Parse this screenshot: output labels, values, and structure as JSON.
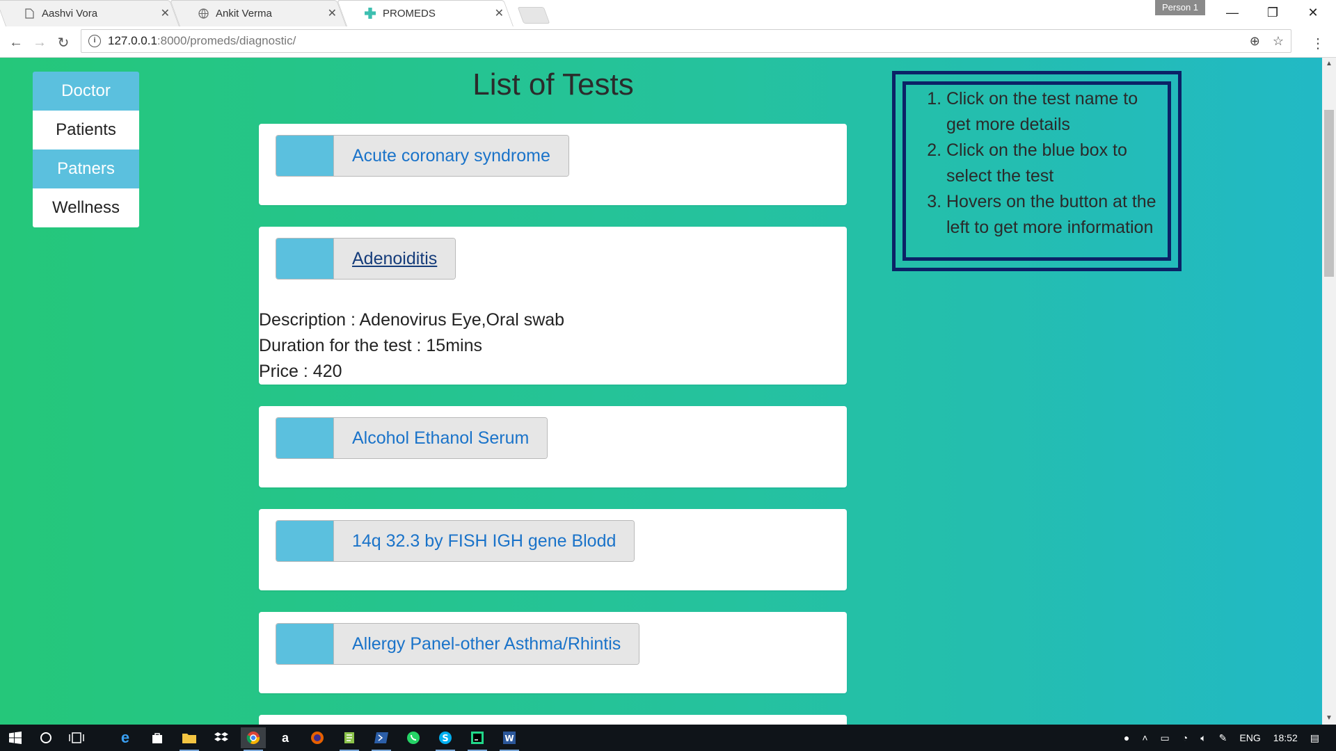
{
  "browser": {
    "tabs": [
      {
        "title": "Aashvi Vora",
        "icon": "document-icon"
      },
      {
        "title": "Ankit Verma",
        "icon": "globe-icon"
      },
      {
        "title": "PROMEDS",
        "icon": "medical-cross-icon"
      }
    ],
    "profile": "Person 1",
    "url": {
      "host": "127.0.0.1",
      "path": ":8000/promeds/diagnostic/"
    }
  },
  "sidebar": {
    "items": [
      {
        "label": "Doctor",
        "style": "blue"
      },
      {
        "label": "Patients",
        "style": "white"
      },
      {
        "label": "Patners",
        "style": "blue"
      },
      {
        "label": "Wellness",
        "style": "white"
      }
    ]
  },
  "main": {
    "title": "List of Tests",
    "tests": [
      {
        "name": "Acute coronary syndrome"
      },
      {
        "name": "Adenoiditis",
        "expanded": true,
        "description": "Description : Adenovirus Eye,Oral swab",
        "duration": "Duration for the test : 15mins",
        "price": "Price : 420"
      },
      {
        "name": "Alcohol Ethanol Serum"
      },
      {
        "name": "14q 32.3 by FISH IGH gene Blodd"
      },
      {
        "name": "Allergy Panel-other Asthma/Rhintis"
      }
    ]
  },
  "instructions": {
    "items": [
      "Click on the test name to get more details",
      "Click on the blue box to select the test",
      "Hovers on the button at the left to get more information"
    ]
  },
  "taskbar": {
    "language": "ENG",
    "time": "18:52"
  },
  "colors": {
    "accent_blue": "#5bc0de",
    "link_blue": "#1a73c9",
    "instruction_border": "#0b2266",
    "bg_gradient_start": "#25c77a",
    "bg_gradient_end": "#22b9c5"
  }
}
